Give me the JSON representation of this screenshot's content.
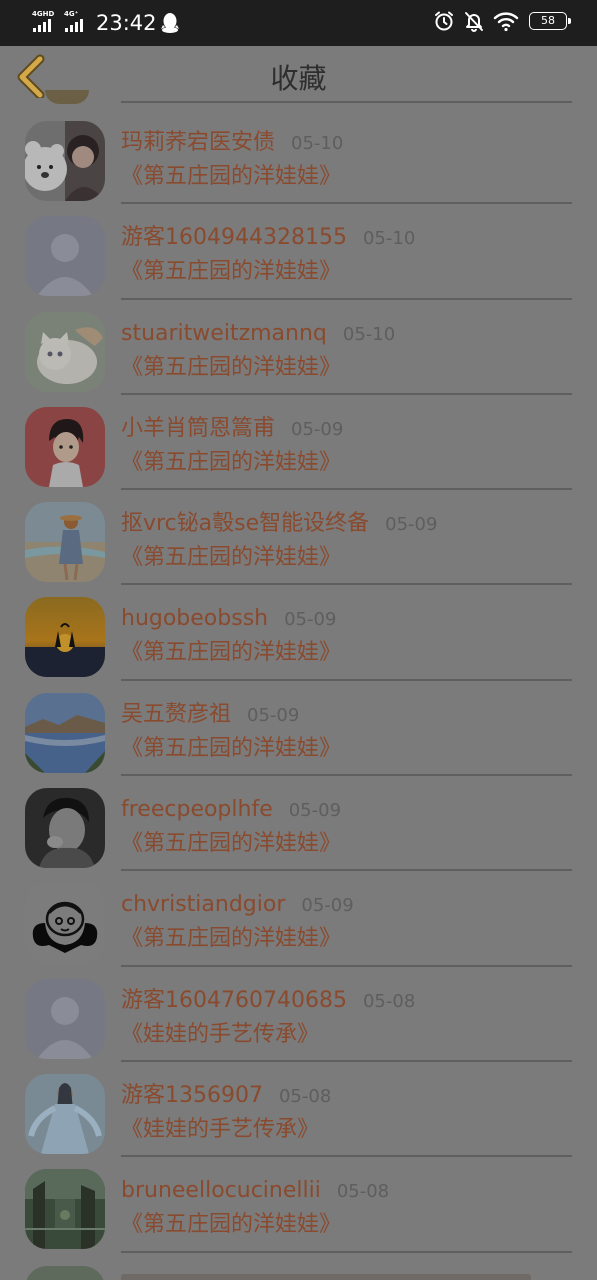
{
  "status_bar": {
    "time": "23:42",
    "sim1_label": "4GHD",
    "sim2_label": "4G⁺",
    "battery": "58",
    "icons": [
      "signal-icon",
      "qq-icon",
      "alarm-icon",
      "mute-icon",
      "wifi-icon",
      "battery-icon"
    ]
  },
  "header": {
    "title": "收藏",
    "back_icon": "chevron-left-icon"
  },
  "colors": {
    "username": "#8a4a2e",
    "date": "#5e5e5e",
    "back_chevron": "#d4a94a",
    "background_dim": "#7b7b7b"
  },
  "favorites": [
    {
      "user": "玛莉荞宕医安债",
      "date": "05-10",
      "work": "《第五庄园的洋娃娃》",
      "avatar": "avatar-girl-bear"
    },
    {
      "user": "游客1604944328155",
      "date": "05-10",
      "work": "《第五庄园的洋娃娃》",
      "avatar": "avatar-default"
    },
    {
      "user": "stuaritweitzmannq",
      "date": "05-10",
      "work": "《第五庄园的洋娃娃》",
      "avatar": "avatar-kitten"
    },
    {
      "user": "小羊肖筒恩篙甫",
      "date": "05-09",
      "work": "《第五庄园的洋娃娃》",
      "avatar": "avatar-anime"
    },
    {
      "user": "抠vrc铋a彀se智能设终备",
      "date": "05-09",
      "work": "《第五庄园的洋娃娃》",
      "avatar": "avatar-beach"
    },
    {
      "user": "hugobeobssh",
      "date": "05-09",
      "work": "《第五庄园的洋娃娃》",
      "avatar": "avatar-sunset"
    },
    {
      "user": "吴五赘彦祖",
      "date": "05-09",
      "work": "《第五庄园的洋娃娃》",
      "avatar": "avatar-lake"
    },
    {
      "user": "freecpeoplhfe",
      "date": "05-09",
      "work": "《第五庄园的洋娃娃》",
      "avatar": "avatar-bw-boy"
    },
    {
      "user": "chvristiandgior",
      "date": "05-09",
      "work": "《第五庄园的洋娃娃》",
      "avatar": "avatar-cartoon"
    },
    {
      "user": "游客1604760740685",
      "date": "05-08",
      "work": "《娃娃的手艺传承》",
      "avatar": "avatar-default"
    },
    {
      "user": "游客1356907",
      "date": "05-08",
      "work": "《娃娃的手艺传承》",
      "avatar": "avatar-hanfu"
    },
    {
      "user": "bruneellocucinellii",
      "date": "05-08",
      "work": "《第五庄园的洋娃娃》",
      "avatar": "avatar-street"
    }
  ]
}
